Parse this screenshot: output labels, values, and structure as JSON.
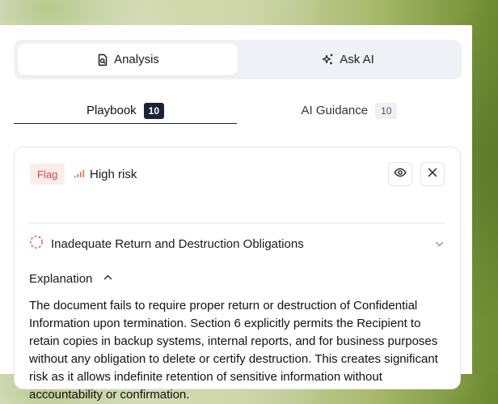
{
  "segmented": {
    "analysis_label": "Analysis",
    "ask_ai_label": "Ask AI"
  },
  "tabs": [
    {
      "label": "Playbook",
      "count": "10"
    },
    {
      "label": "AI Guidance",
      "count": "10"
    }
  ],
  "card": {
    "flag_label": "Flag",
    "risk_label": "High risk",
    "issue_title": "Inadequate Return and Destruction Obligations",
    "explanation_label": "Explanation",
    "explanation_text": "The document fails to require proper return or destruction of Confidential Information upon termination. Section 6 explicitly permits the Recipient to retain copies in backup systems, internal reports, and for business purposes without any obligation to delete or certify destruction. This creates significant risk as it allows indefinite retention of sensitive information without accountability or confirmation."
  },
  "colors": {
    "flag_text": "#d8453c",
    "flag_bg": "#fdecec",
    "badge_dark": "#1c2433",
    "tab_underline": "#1a1f2e"
  },
  "icons": {
    "analysis": "document-search-icon",
    "ask_ai": "sparkle-icon",
    "risk": "signal-bars-icon",
    "view": "eye-icon",
    "close": "close-icon",
    "issue_status": "dashed-circle-icon",
    "issue_toggle": "chevron-down-icon",
    "explanation_toggle": "chevron-up-icon"
  }
}
